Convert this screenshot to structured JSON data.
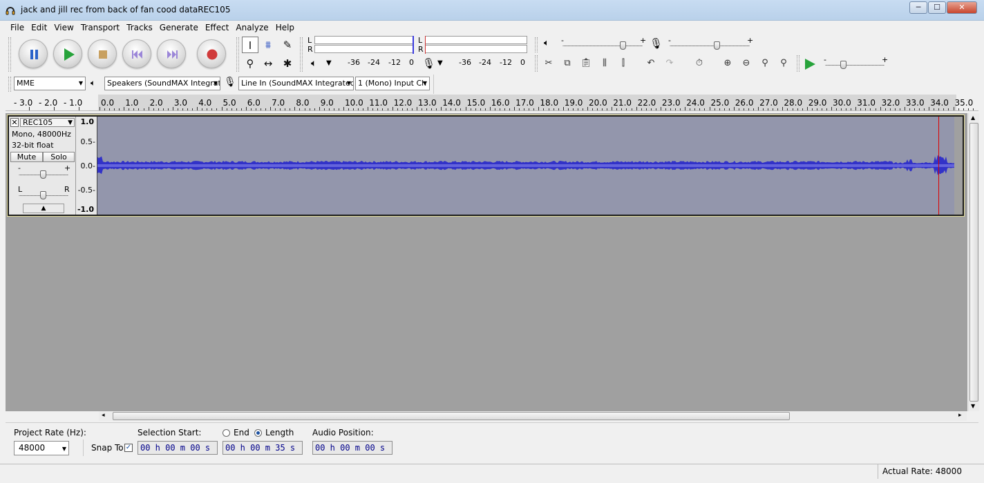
{
  "window": {
    "title": "jack and jill rec from back of fan cood dataREC105",
    "controls": {
      "minimize": "─",
      "maximize": "☐",
      "close": "✕"
    }
  },
  "menu": [
    "File",
    "Edit",
    "View",
    "Transport",
    "Tracks",
    "Generate",
    "Effect",
    "Analyze",
    "Help"
  ],
  "meters": {
    "playback_L": "L",
    "playback_R": "R",
    "record_L": "L",
    "record_R": "R",
    "scale": [
      "-36",
      "-24",
      "-12",
      "0"
    ]
  },
  "mixer": {
    "minus": "-",
    "plus": "+"
  },
  "device": {
    "host": "MME",
    "output": "Speakers (SoundMAX Integrat",
    "input": "Line In (SoundMAX Integrated",
    "channels": "1 (Mono) Input Ch"
  },
  "ruler": {
    "left_labels": [
      "- 3.0",
      "- 2.0",
      "- 1.0"
    ],
    "labels": [
      "0.0",
      "1.0",
      "2.0",
      "3.0",
      "4.0",
      "5.0",
      "6.0",
      "7.0",
      "8.0",
      "9.0",
      "10.0",
      "11.0",
      "12.0",
      "13.0",
      "14.0",
      "15.0",
      "16.0",
      "17.0",
      "18.0",
      "19.0",
      "20.0",
      "21.0",
      "22.0",
      "23.0",
      "24.0",
      "25.0",
      "26.0",
      "27.0",
      "28.0",
      "29.0",
      "30.0",
      "31.0",
      "32.0",
      "33.0",
      "34.0",
      "35.0"
    ]
  },
  "track": {
    "name": "REC105",
    "info1": "Mono, 48000Hz",
    "info2": "32-bit float",
    "mute": "Mute",
    "solo": "Solo",
    "gain_minus": "-",
    "gain_plus": "+",
    "pan_left": "L",
    "pan_right": "R",
    "vruler": [
      "1.0",
      "0.5-",
      "0.0-",
      "-0.5-",
      "-1.0"
    ]
  },
  "waveform": {
    "duration_seconds": 35,
    "color": "#3232c8",
    "background": "#9396ac"
  },
  "selection": {
    "project_rate_label": "Project Rate (Hz):",
    "project_rate": "48000",
    "snap_to": "Snap To",
    "selection_start_label": "Selection Start:",
    "end_label": "End",
    "length_label": "Length",
    "audio_position_label": "Audio Position:",
    "start_time": "00 h 00 m 00 s",
    "length_time": "00 h 00 m 35 s",
    "position_time": "00 h 00 m 00 s"
  },
  "status": {
    "actual_rate": "Actual Rate: 48000"
  }
}
